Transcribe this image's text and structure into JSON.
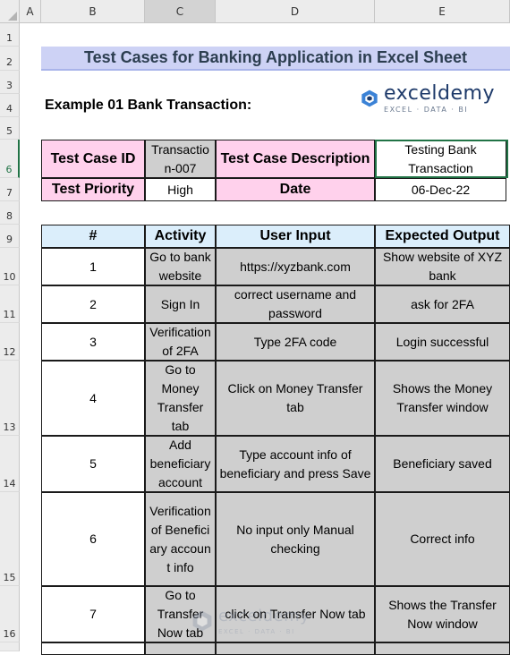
{
  "columns": [
    "A",
    "B",
    "C",
    "D",
    "E"
  ],
  "rows": [
    "1",
    "2",
    "3",
    "4",
    "5",
    "6",
    "7",
    "8",
    "9",
    "10",
    "11",
    "12",
    "13",
    "14",
    "15",
    "16"
  ],
  "title": "Test Cases for Banking Application in Excel Sheet",
  "example_heading": "Example 01 Bank Transaction:",
  "logo": {
    "name": "exceldemy",
    "tagline": "EXCEL · DATA · BI"
  },
  "info": {
    "id_label": "Test Case ID",
    "id_value": "Transaction-007",
    "desc_label": "Test Case Description",
    "desc_value": "Testing Bank Transaction",
    "priority_label": "Test Priority",
    "priority_value": "High",
    "date_label": "Date",
    "date_value": "06-Dec-22"
  },
  "table": {
    "headers": [
      "#",
      "Activity",
      "User Input",
      "Expected Output"
    ],
    "rows": [
      {
        "num": "1",
        "activity": "Go to bank website",
        "input": "https://xyzbank.com",
        "output": "Show website of XYZ bank"
      },
      {
        "num": "2",
        "activity": "Sign In",
        "input": "correct username and password",
        "output": "ask for 2FA"
      },
      {
        "num": "3",
        "activity": "Verification of 2FA",
        "input": "Type 2FA code",
        "output": "Login successful"
      },
      {
        "num": "4",
        "activity": "Go to Money Transfer tab",
        "input": "Click on Money Transfer tab",
        "output": "Shows the Money Transfer window"
      },
      {
        "num": "5",
        "activity": "Add beneficiary account",
        "input": "Type account info of beneficiary and press Save",
        "output": "Beneficiary saved"
      },
      {
        "num": "6",
        "activity": "Verification of Beneficiary account info",
        "input": "No input only Manual checking",
        "output": "Correct info"
      },
      {
        "num": "7",
        "activity": "Go to Transfer Now tab",
        "input": "click on Transfer Now tab",
        "output": "Shows the Transfer Now window"
      }
    ]
  },
  "colors": {
    "title_bg": "#cdd2f5",
    "pink": "#ffd1ec",
    "gray": "#cfcfcf",
    "header_blue": "#dbeefb",
    "excel_green": "#217346"
  }
}
